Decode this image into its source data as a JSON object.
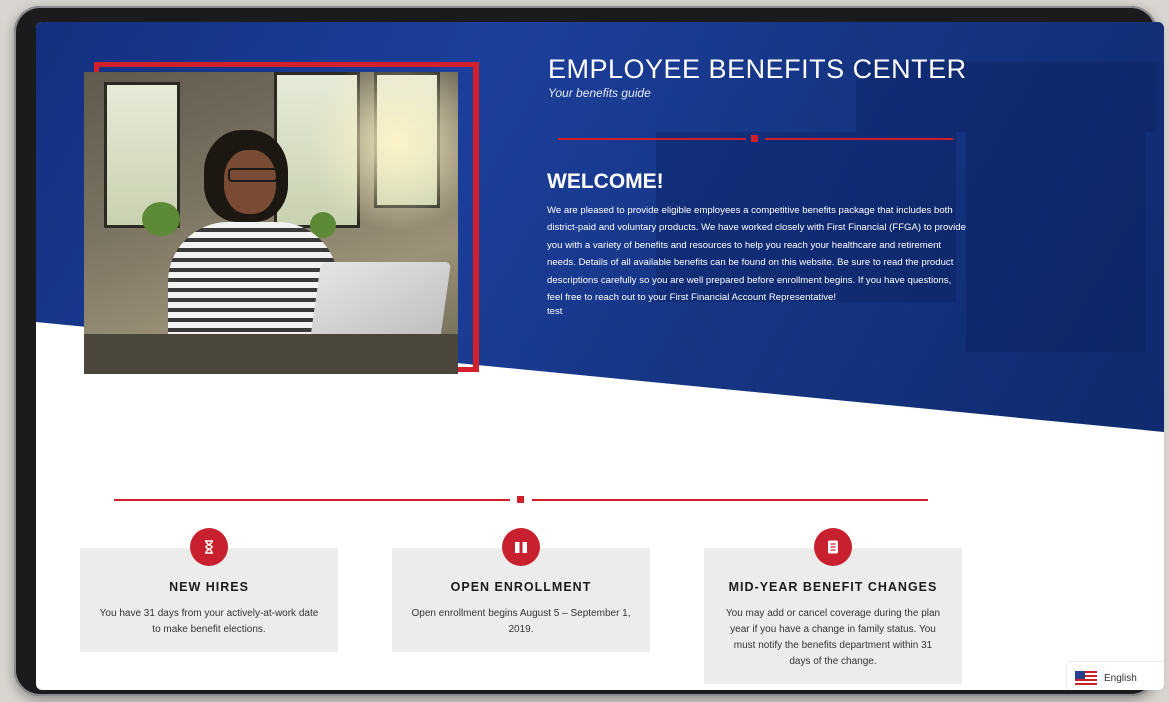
{
  "header": {
    "title": "EMPLOYEE BENEFITS CENTER",
    "subtitle": "Your benefits guide"
  },
  "welcome": {
    "heading": "WELCOME!",
    "body": "We are pleased to provide eligible employees a competitive benefits package that includes both district-paid and voluntary products. We have worked closely with First Financial (FFGA) to provide you with a variety of benefits and resources to help you reach your healthcare and retirement needs. Details of all available benefits can be found on this website. Be sure to read the product descriptions carefully so you are well prepared before enrollment begins. If you have questions, feel free to reach out to your First Financial Account Representative!",
    "note": "test"
  },
  "cards": [
    {
      "icon": "hourglass-icon",
      "title": "NEW HIRES",
      "text": "You have 31 days from your actively-at-work date to make benefit elections."
    },
    {
      "icon": "book-icon",
      "title": "OPEN ENROLLMENT",
      "text": "Open enrollment begins August 5 – September 1, 2019."
    },
    {
      "icon": "document-icon",
      "title": "MID-YEAR BENEFIT CHANGES",
      "text": "You may add or cancel coverage during the plan year if you have a change in family status. You must notify the benefits department within 31 days of the change."
    }
  ],
  "language": {
    "label": "English",
    "flag": "us-flag-icon"
  },
  "colors": {
    "accent": "#d11f2b",
    "hero_blue": "#1c3f9c"
  }
}
